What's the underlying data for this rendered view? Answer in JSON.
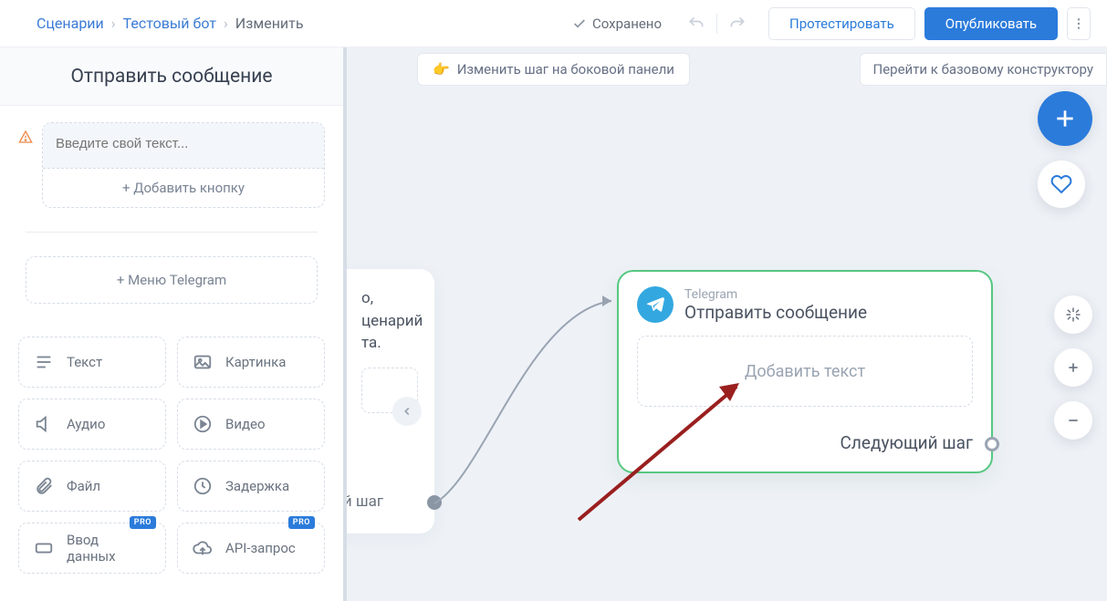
{
  "header": {
    "breadcrumb": {
      "root": "Сценарии",
      "bot": "Тестовый бот",
      "current": "Изменить"
    },
    "saved": "Сохранено",
    "test_btn": "Протестировать",
    "publish_btn": "Опубликовать"
  },
  "top": {
    "hint": "Изменить шаг на боковой панели",
    "goto": "Перейти к базовому конструктору"
  },
  "sidebar": {
    "title": "Отправить сообщение",
    "msg_placeholder": "Введите свой текст...",
    "add_button": "+ Добавить кнопку",
    "add_menu": "+ Меню Telegram",
    "types": {
      "text": "Текст",
      "image": "Картинка",
      "audio": "Аудио",
      "video": "Видео",
      "file": "Файл",
      "delay": "Задержка",
      "input": "Ввод данных",
      "api": "API-запрос",
      "pro": "PRO"
    }
  },
  "canvas": {
    "partial_text_l1": "о,",
    "partial_text_l2": "ценарий",
    "partial_text_l3": "та.",
    "partial_next": "рвый шаг",
    "card": {
      "channel": "Telegram",
      "title": "Отправить сообщение",
      "placeholder": "Добавить текст",
      "next": "Следующий шаг"
    }
  }
}
